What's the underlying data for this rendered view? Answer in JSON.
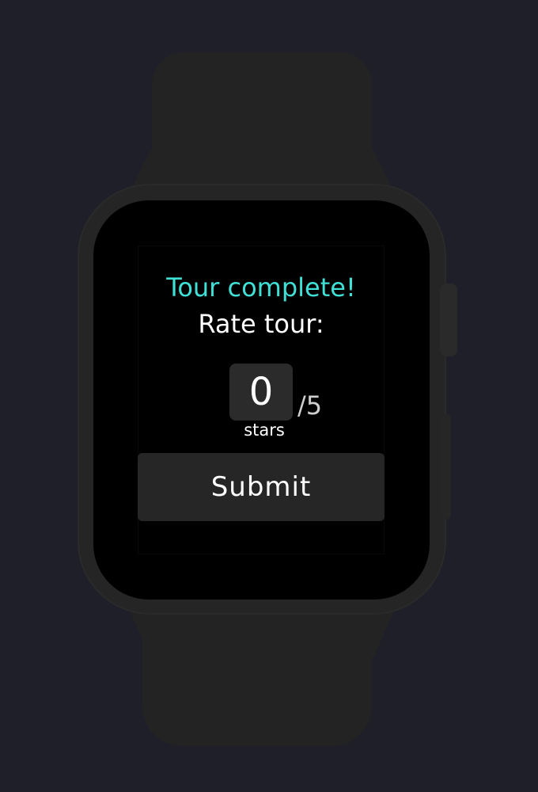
{
  "screen": {
    "title": "Tour complete!",
    "subtitle": "Rate tour:"
  },
  "rating": {
    "value": "0",
    "max_label": "/5",
    "unit_label": "stars"
  },
  "actions": {
    "submit_label": "Submit"
  },
  "colors": {
    "background": "#1e1f28",
    "accent": "#3fe0d6",
    "watch_body": "#232323",
    "screen": "#000000"
  }
}
